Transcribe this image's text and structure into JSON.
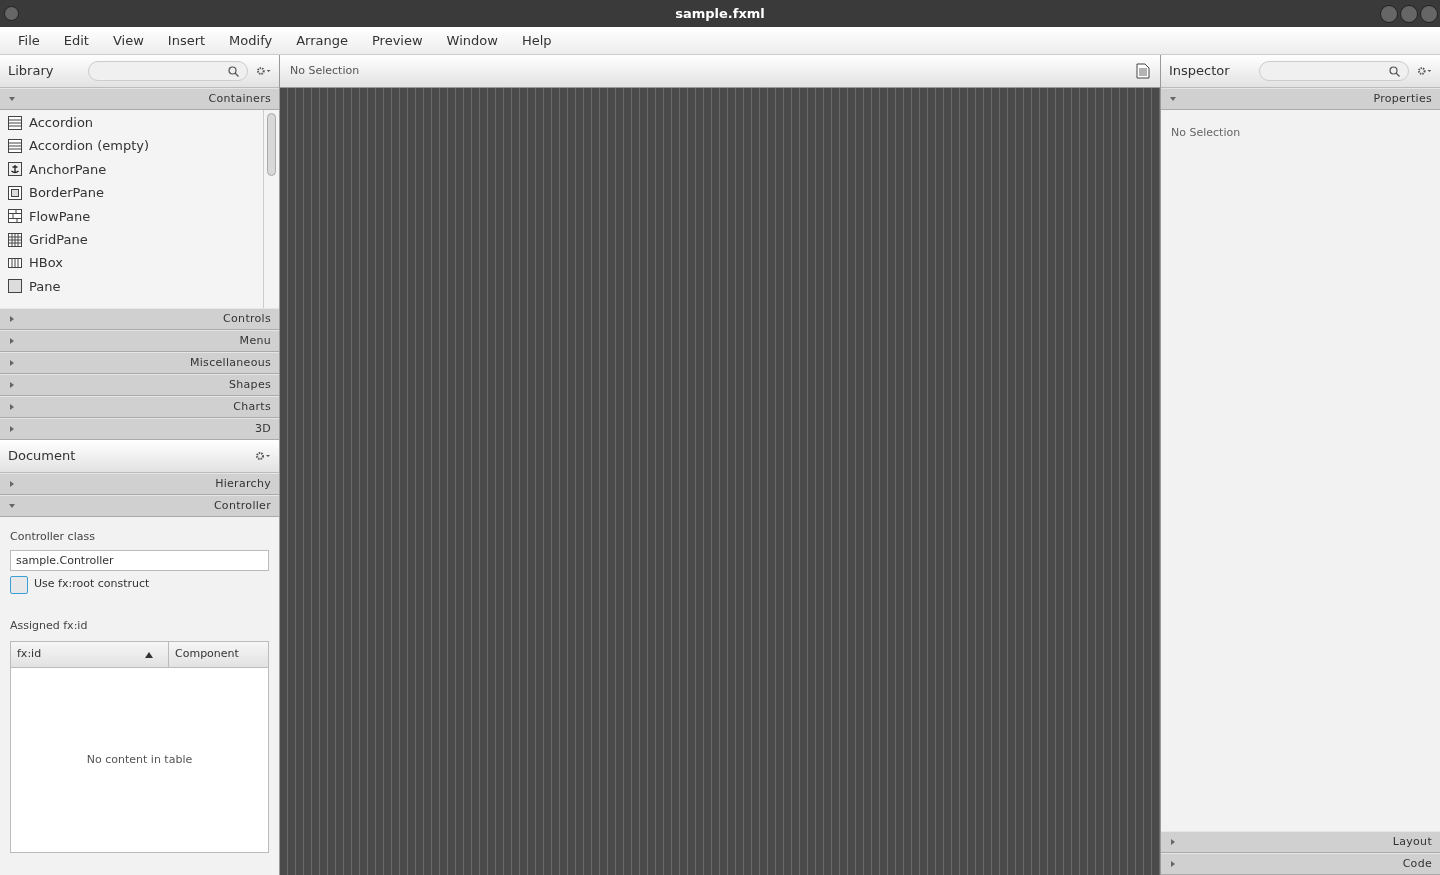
{
  "window": {
    "title": "sample.fxml"
  },
  "menu": [
    "File",
    "Edit",
    "View",
    "Insert",
    "Modify",
    "Arrange",
    "Preview",
    "Window",
    "Help"
  ],
  "library": {
    "title": "Library",
    "sections": [
      {
        "label": "Containers",
        "expanded": true,
        "items": [
          {
            "label": "Accordion",
            "kind": "accordion"
          },
          {
            "label": "Accordion  (empty)",
            "kind": "accordion"
          },
          {
            "label": "AnchorPane",
            "kind": "anchor"
          },
          {
            "label": "BorderPane",
            "kind": "border"
          },
          {
            "label": "FlowPane",
            "kind": "flow"
          },
          {
            "label": "GridPane",
            "kind": "grid"
          },
          {
            "label": "HBox",
            "kind": "hbox"
          },
          {
            "label": "Pane",
            "kind": "pane"
          }
        ]
      },
      {
        "label": "Controls",
        "expanded": false
      },
      {
        "label": "Menu",
        "expanded": false
      },
      {
        "label": "Miscellaneous",
        "expanded": false
      },
      {
        "label": "Shapes",
        "expanded": false
      },
      {
        "label": "Charts",
        "expanded": false
      },
      {
        "label": "3D",
        "expanded": false
      }
    ]
  },
  "document": {
    "title": "Document",
    "sections": [
      {
        "label": "Hierarchy",
        "expanded": false
      },
      {
        "label": "Controller",
        "expanded": true
      }
    ],
    "controller_class_label": "Controller class",
    "controller_class": "sample.Controller",
    "fx_root": {
      "label": "Use fx:root construct",
      "checked": false
    },
    "assigned_label": "Assigned fx:id",
    "table": {
      "columns": [
        {
          "label": "fx:id",
          "sorted": true
        },
        {
          "label": "Component",
          "sorted": false
        }
      ],
      "empty_text": "No content in table"
    }
  },
  "content": {
    "status": "No Selection"
  },
  "inspector": {
    "title": "Inspector",
    "sections": [
      {
        "label": "Properties",
        "expanded": true
      },
      {
        "label": "Layout",
        "expanded": false
      },
      {
        "label": "Code",
        "expanded": false
      }
    ],
    "empty_text": "No Selection"
  }
}
